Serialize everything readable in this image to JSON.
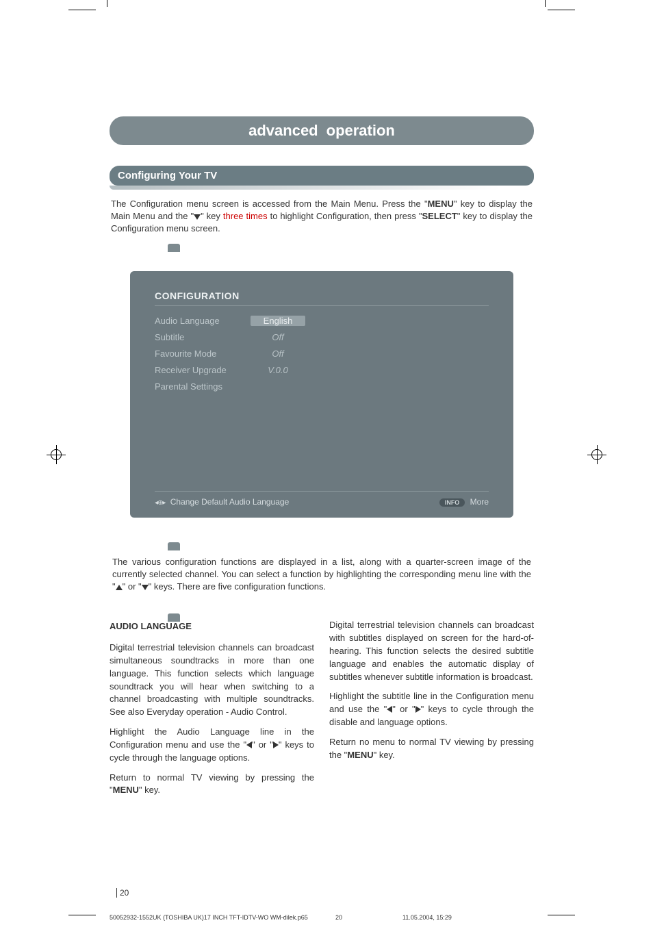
{
  "header": {
    "title_left": "advanced",
    "title_right": "operation"
  },
  "section_title": "Configuring Your TV",
  "intro": {
    "part1": "The Configuration menu screen is accessed from the Main Menu. Press the \"",
    "menu_bold": "MENU",
    "part2": "\" key to display the Main Menu and the \"",
    "part3": "\" key ",
    "red_text": "three times",
    "part4": " to highlight Configuration, then press \"",
    "select_bold": "SELECT",
    "part5": "\" key to display the Configuration menu screen."
  },
  "osd": {
    "title": "CONFIGURATION",
    "rows": [
      {
        "label": "Audio Language",
        "value": "English",
        "highlighted": true
      },
      {
        "label": "Subtitle",
        "value": "Off",
        "highlighted": false
      },
      {
        "label": "Favourite Mode",
        "value": "Off",
        "highlighted": false
      },
      {
        "label": "Receiver Upgrade",
        "value": "V.0.0",
        "highlighted": false
      },
      {
        "label": "Parental Settings",
        "value": "",
        "highlighted": false
      }
    ],
    "hint_left": "Change Default Audio Language",
    "info_label": "INFO",
    "hint_right": "More"
  },
  "explain": {
    "part1": "The various configuration functions are displayed in a list, along with a quarter-screen image of the currently selected channel. You can select a function by highlighting the corresponding menu line with the \"",
    "part2": "\" or \"",
    "part3": "\" keys. There are five configuration  functions."
  },
  "col_left": {
    "heading": "AUDIO LANGUAGE",
    "p1": "Digital terrestrial television channels can broadcast simultaneous soundtracks in more than one language. This function selects which language soundtrack you will hear when switching to a channel broadcasting with multiple soundtracks. See also Everyday operation - Audio Control.",
    "p2a": "Highlight the Audio Language line in the Configuration menu and use the \"",
    "p2b": "\" or \"",
    "p2c": "\" keys to cycle through the language options.",
    "p3a": "Return to normal TV viewing by pressing the \"",
    "p3_bold": "MENU",
    "p3b": "\" key."
  },
  "col_right": {
    "p1": "Digital terrestrial television channels can broadcast with subtitles displayed on screen for the hard-of-hearing. This function selects the desired subtitle language and enables the automatic display of subtitles whenever subtitle information is broadcast.",
    "p2a": "Highlight the subtitle line in the Configuration menu and use the \"",
    "p2b": "\" or \"",
    "p2c": "\" keys to cycle through the disable and language options.",
    "p3a": "Return no menu to normal TV viewing by pressing the \"",
    "p3_bold": "MENU",
    "p3b": "\" key."
  },
  "page_number": "20",
  "footer": {
    "filename": "50052932-1552UK (TOSHIBA UK)17 INCH TFT-IDTV-WO WM-dilek.p65",
    "pg": "20",
    "datetime": "11.05.2004, 15:29"
  }
}
